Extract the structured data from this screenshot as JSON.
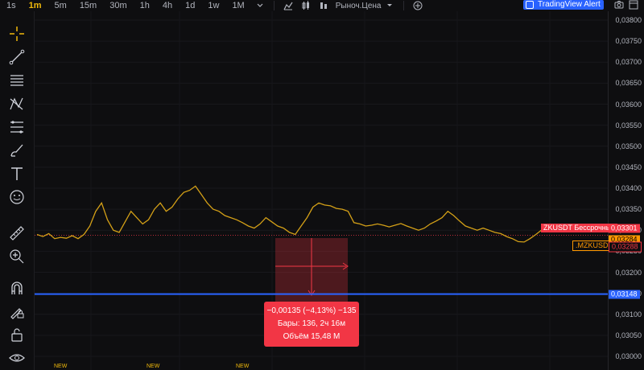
{
  "timeframes": [
    {
      "label": "1s",
      "active": false
    },
    {
      "label": "1m",
      "active": true
    },
    {
      "label": "5m",
      "active": false
    },
    {
      "label": "15m",
      "active": false
    },
    {
      "label": "30m",
      "active": false
    },
    {
      "label": "1h",
      "active": false
    },
    {
      "label": "4h",
      "active": false
    },
    {
      "label": "1d",
      "active": false
    },
    {
      "label": "1w",
      "active": false
    },
    {
      "label": "1M",
      "active": false
    }
  ],
  "toolbar": {
    "price_type_label": "Рыноч.Цена",
    "alert_label": "TradingView Alert"
  },
  "left_tools": [
    "crosshair-icon",
    "trend-line-icon",
    "horizontal-lines-icon",
    "pattern-icon",
    "fib-icon",
    "brush-icon",
    "text-icon",
    "emoji-icon",
    "ruler-icon",
    "zoom-icon",
    "magnet-icon",
    "draw-lock-icon",
    "unlock-icon",
    "eye-icon"
  ],
  "price_axis": {
    "ticks": [
      "0,03800",
      "0,03750",
      "0,03700",
      "0,03650",
      "0,03600",
      "0,03550",
      "0,03500",
      "0,03450",
      "0,03400",
      "0,03350",
      "0,03300",
      "0,03250",
      "0,03200",
      "0,03150",
      "0,03100",
      "0,03050",
      "0,03000"
    ],
    "tick_values": [
      0.038,
      0.0375,
      0.037,
      0.0365,
      0.036,
      0.0355,
      0.035,
      0.0345,
      0.034,
      0.0335,
      0.033,
      0.0325,
      0.032,
      0.0315,
      0.031,
      0.0305,
      0.03
    ]
  },
  "symbols": {
    "main_label": "ZKUSDT Бессрочный",
    "main_price": "0,03301",
    "main_value": 0.03301,
    "main_color": "#f23645",
    "compare_label": ".MZKUSDT",
    "compare_price": "0,03284",
    "compare_value": 0.03284,
    "compare_color": "#ff9800",
    "ref_price": "0,03288",
    "ref_value": 0.03288,
    "line_price": "0,03148",
    "line_value": 0.03148,
    "line_color": "#2962ff"
  },
  "measure": {
    "line1": "−0,00135 (−4,13%) −135",
    "line2": "Бары: 136, 2ч 16м",
    "line3": "Объём 15,48 M",
    "color": "#f23645"
  },
  "new_tags": [
    "NEW",
    "NEW",
    "NEW"
  ],
  "chart_data": {
    "type": "line",
    "ylim": [
      0.03,
      0.0381
    ],
    "series": [
      {
        "values": [
          0.0329,
          0.03285,
          0.03292,
          0.0328,
          0.03283,
          0.03281,
          0.03287,
          0.0328,
          0.0329,
          0.0331,
          0.03345,
          0.03365,
          0.03325,
          0.033,
          0.03295,
          0.0332,
          0.03345,
          0.0333,
          0.03315,
          0.03325,
          0.0335,
          0.03365,
          0.03345,
          0.03355,
          0.03375,
          0.0339,
          0.03395,
          0.03405,
          0.03385,
          0.03365,
          0.0335,
          0.03345,
          0.03335,
          0.0333,
          0.03325,
          0.03318,
          0.0331,
          0.03305,
          0.03315,
          0.0333,
          0.0332,
          0.0331,
          0.03305,
          0.03295,
          0.0329,
          0.0331,
          0.0333,
          0.03355,
          0.03365,
          0.0336,
          0.03358,
          0.03352,
          0.0335,
          0.03345,
          0.03318,
          0.03315,
          0.0331,
          0.03312,
          0.03315,
          0.03312,
          0.03308,
          0.03312,
          0.03316,
          0.0331,
          0.03305,
          0.033,
          0.03305,
          0.03315,
          0.03322,
          0.0333,
          0.03345,
          0.03335,
          0.03322,
          0.0331,
          0.03305,
          0.033,
          0.03305,
          0.033,
          0.03295,
          0.03292,
          0.03285,
          0.0328,
          0.03273,
          0.03272,
          0.0328,
          0.0329,
          0.03301
        ]
      }
    ]
  }
}
